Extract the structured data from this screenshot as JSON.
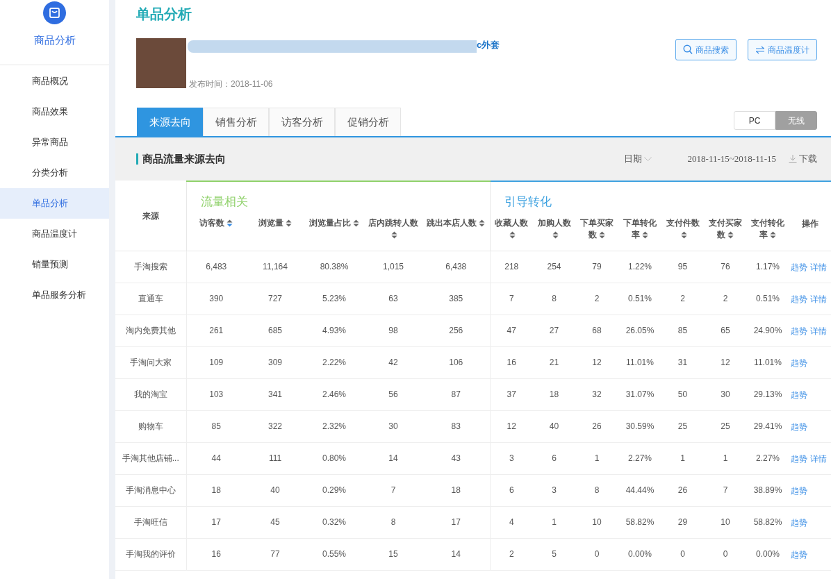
{
  "sidebar": {
    "module_title": "商品分析",
    "items": [
      {
        "label": "商品概况",
        "selected": false
      },
      {
        "label": "商品效果",
        "selected": false
      },
      {
        "label": "异常商品",
        "selected": false
      },
      {
        "label": "分类分析",
        "selected": false
      },
      {
        "label": "单品分析",
        "selected": true
      },
      {
        "label": "商品温度计",
        "selected": false
      },
      {
        "label": "销量预测",
        "selected": false
      },
      {
        "label": "单品服务分析",
        "selected": false
      }
    ]
  },
  "page_title": "单品分析",
  "product": {
    "title": "c外套",
    "published": "发布时间：2018-11-06"
  },
  "buttons": [
    {
      "label": "商品搜索",
      "kind": "search"
    },
    {
      "label": "商品温度计",
      "kind": "swap"
    }
  ],
  "tabs": [
    {
      "label": "来源去向",
      "selected": true
    },
    {
      "label": "销售分析",
      "selected": false
    },
    {
      "label": "访客分析",
      "selected": false
    },
    {
      "label": "促销分析",
      "selected": false
    }
  ],
  "platform_toggle": [
    {
      "label": "PC",
      "selected": false
    },
    {
      "label": "无线",
      "selected": true
    }
  ],
  "section": {
    "title": "商品流量来源去向",
    "date_label": "日期",
    "date_range": "2018-11-15~2018-11-15",
    "download": "下载"
  },
  "table": {
    "source_header": "来源",
    "groups": [
      {
        "title": "流量相关",
        "color": "#8fd16a",
        "columns": [
          {
            "label": "访客数",
            "sorted": true
          },
          {
            "label": "浏览量",
            "sorted": false
          },
          {
            "label": "浏览量占比",
            "sorted": false
          },
          {
            "label": "店内跳转人数",
            "sorted": false
          },
          {
            "label": "跳出本店人数",
            "sorted": false
          }
        ]
      },
      {
        "title": "引导转化",
        "color": "#3fa2e0",
        "columns": [
          {
            "label": "收藏人数",
            "sorted": false
          },
          {
            "label": "加购人数",
            "sorted": false
          },
          {
            "label": "下单买家数",
            "sorted": false
          },
          {
            "label": "下单转化率",
            "sorted": false
          },
          {
            "label": "支付件数",
            "sorted": false
          },
          {
            "label": "支付买家数",
            "sorted": false
          },
          {
            "label": "支付转化率",
            "sorted": false
          }
        ]
      }
    ],
    "action_header": "操作",
    "rows": [
      {
        "source": "手淘搜索",
        "values": [
          "6,483",
          "11,164",
          "80.38%",
          "1,015",
          "6,438",
          "218",
          "254",
          "79",
          "1.22%",
          "95",
          "76",
          "1.17%"
        ],
        "actions": [
          "趋势",
          "详情"
        ]
      },
      {
        "source": "直通车",
        "values": [
          "390",
          "727",
          "5.23%",
          "63",
          "385",
          "7",
          "8",
          "2",
          "0.51%",
          "2",
          "2",
          "0.51%"
        ],
        "actions": [
          "趋势",
          "详情"
        ]
      },
      {
        "source": "淘内免费其他",
        "values": [
          "261",
          "685",
          "4.93%",
          "98",
          "256",
          "47",
          "27",
          "68",
          "26.05%",
          "85",
          "65",
          "24.90%"
        ],
        "actions": [
          "趋势",
          "详情"
        ]
      },
      {
        "source": "手淘问大家",
        "values": [
          "109",
          "309",
          "2.22%",
          "42",
          "106",
          "16",
          "21",
          "12",
          "11.01%",
          "31",
          "12",
          "11.01%"
        ],
        "actions": [
          "趋势"
        ]
      },
      {
        "source": "我的淘宝",
        "values": [
          "103",
          "341",
          "2.46%",
          "56",
          "87",
          "37",
          "18",
          "32",
          "31.07%",
          "50",
          "30",
          "29.13%"
        ],
        "actions": [
          "趋势"
        ]
      },
      {
        "source": "购物车",
        "values": [
          "85",
          "322",
          "2.32%",
          "30",
          "83",
          "12",
          "40",
          "26",
          "30.59%",
          "25",
          "25",
          "29.41%"
        ],
        "actions": [
          "趋势"
        ]
      },
      {
        "source": "手淘其他店铺...",
        "values": [
          "44",
          "111",
          "0.80%",
          "14",
          "43",
          "3",
          "6",
          "1",
          "2.27%",
          "1",
          "1",
          "2.27%"
        ],
        "actions": [
          "趋势",
          "详情"
        ]
      },
      {
        "source": "手淘消息中心",
        "values": [
          "18",
          "40",
          "0.29%",
          "7",
          "18",
          "6",
          "3",
          "8",
          "44.44%",
          "26",
          "7",
          "38.89%"
        ],
        "actions": [
          "趋势"
        ]
      },
      {
        "source": "手淘旺信",
        "values": [
          "17",
          "45",
          "0.32%",
          "8",
          "17",
          "4",
          "1",
          "10",
          "58.82%",
          "29",
          "10",
          "58.82%"
        ],
        "actions": [
          "趋势"
        ]
      },
      {
        "source": "手淘我的评价",
        "values": [
          "16",
          "77",
          "0.55%",
          "15",
          "14",
          "2",
          "5",
          "0",
          "0.00%",
          "0",
          "0",
          "0.00%"
        ],
        "actions": [
          "趋势"
        ]
      }
    ]
  }
}
